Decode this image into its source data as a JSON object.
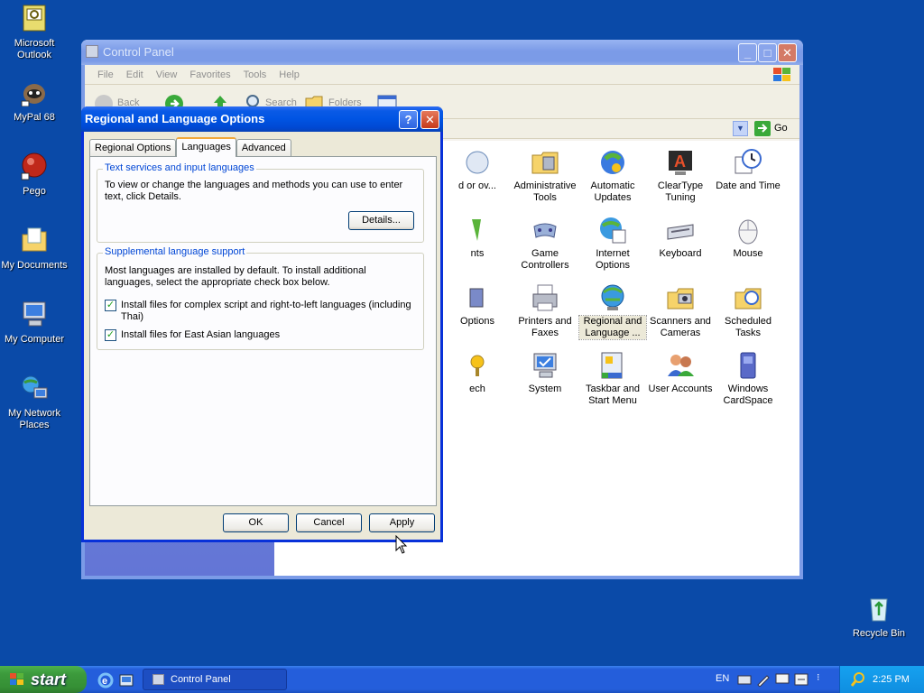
{
  "desktop": {
    "icons": [
      {
        "label": "Microsoft Outlook",
        "icon": "outlook-icon"
      },
      {
        "label": "MyPal 68",
        "icon": "mypal-icon"
      },
      {
        "label": "Pego",
        "icon": "pego-icon"
      },
      {
        "label": "My Documents",
        "icon": "my-documents-icon"
      },
      {
        "label": "My Computer",
        "icon": "my-computer-icon"
      },
      {
        "label": "My Network Places",
        "icon": "network-places-icon"
      },
      {
        "label": "Recycle Bin",
        "icon": "recycle-bin-icon"
      }
    ]
  },
  "control_panel": {
    "title": "Control Panel",
    "menu": [
      "File",
      "Edit",
      "View",
      "Favorites",
      "Tools",
      "Help"
    ],
    "toolbar": {
      "back": "Back",
      "search": "Search",
      "folders": "Folders"
    },
    "address": {
      "go": "Go"
    },
    "items": [
      {
        "label": "d or ov...",
        "icon": "partial-icon"
      },
      {
        "label": "Administrative Tools",
        "icon": "administrative-tools-icon"
      },
      {
        "label": "Automatic Updates",
        "icon": "automatic-updates-icon"
      },
      {
        "label": "ClearType Tuning",
        "icon": "cleartype-icon"
      },
      {
        "label": "Date and Time",
        "icon": "date-time-icon"
      },
      {
        "label": "nts",
        "icon": "partial-icon"
      },
      {
        "label": "Game Controllers",
        "icon": "game-controllers-icon"
      },
      {
        "label": "Internet Options",
        "icon": "internet-options-icon"
      },
      {
        "label": "Keyboard",
        "icon": "keyboard-icon"
      },
      {
        "label": "Mouse",
        "icon": "mouse-icon"
      },
      {
        "label": "Options",
        "icon": "partial-icon"
      },
      {
        "label": "Printers and Faxes",
        "icon": "printers-icon"
      },
      {
        "label": "Regional and Language ...",
        "icon": "regional-icon"
      },
      {
        "label": "Scanners and Cameras",
        "icon": "scanners-icon"
      },
      {
        "label": "Scheduled Tasks",
        "icon": "scheduled-tasks-icon"
      },
      {
        "label": "ech",
        "icon": "partial-icon"
      },
      {
        "label": "System",
        "icon": "system-icon"
      },
      {
        "label": "Taskbar and Start Menu",
        "icon": "taskbar-icon"
      },
      {
        "label": "User Accounts",
        "icon": "user-accounts-icon"
      },
      {
        "label": "Windows CardSpace",
        "icon": "cardspace-icon"
      }
    ]
  },
  "dialog": {
    "title": "Regional and Language Options",
    "tabs": [
      "Regional Options",
      "Languages",
      "Advanced"
    ],
    "active_tab": "Languages",
    "group1": {
      "legend": "Text services and input languages",
      "text": "To view or change the languages and methods you can use to enter text, click Details.",
      "details_button": "Details..."
    },
    "group2": {
      "legend": "Supplemental language support",
      "text": "Most languages are installed by default. To install additional languages, select the appropriate check box below.",
      "checkbox1": "Install files for complex script and right-to-left languages (including Thai)",
      "checkbox2": "Install files for East Asian languages"
    },
    "buttons": {
      "ok": "OK",
      "cancel": "Cancel",
      "apply": "Apply"
    }
  },
  "taskbar": {
    "start": "start",
    "task": "Control Panel",
    "language": "EN",
    "clock": "2:25 PM"
  },
  "colors": {
    "desktop": "#0a4aa8",
    "taskbar": "#245edb",
    "start_button": "#3c9a3c",
    "title_active": "#0054e3"
  }
}
